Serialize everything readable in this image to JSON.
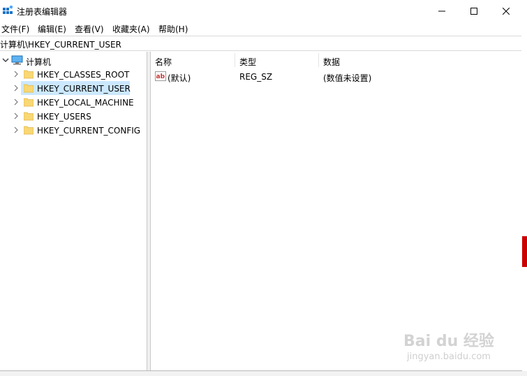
{
  "window": {
    "title": "注册表编辑器",
    "controls": {
      "minimize": "minimize",
      "maximize": "maximize",
      "close": "close"
    }
  },
  "menu": {
    "items": [
      "文件(F)",
      "编辑(E)",
      "查看(V)",
      "收藏夹(A)",
      "帮助(H)"
    ]
  },
  "address": {
    "path": "计算机\\HKEY_CURRENT_USER"
  },
  "tree": {
    "root": {
      "label": "计算机",
      "icon": "computer-icon",
      "expanded": true
    },
    "children": [
      {
        "label": "HKEY_CLASSES_ROOT",
        "selected": false
      },
      {
        "label": "HKEY_CURRENT_USER",
        "selected": true
      },
      {
        "label": "HKEY_LOCAL_MACHINE",
        "selected": false
      },
      {
        "label": "HKEY_USERS",
        "selected": false
      },
      {
        "label": "HKEY_CURRENT_CONFIG",
        "selected": false
      }
    ]
  },
  "list": {
    "columns": [
      "名称",
      "类型",
      "数据"
    ],
    "rows": [
      {
        "name": "(默认)",
        "type": "REG_SZ",
        "data": "(数值未设置)",
        "icon": "string-value-icon"
      }
    ]
  },
  "watermark": {
    "text": "Bai du 经验",
    "sub": "jingyan.baidu.com"
  },
  "colors": {
    "selection": "#cce8ff",
    "folder": "#f8d775",
    "accent": "#0078d7"
  }
}
